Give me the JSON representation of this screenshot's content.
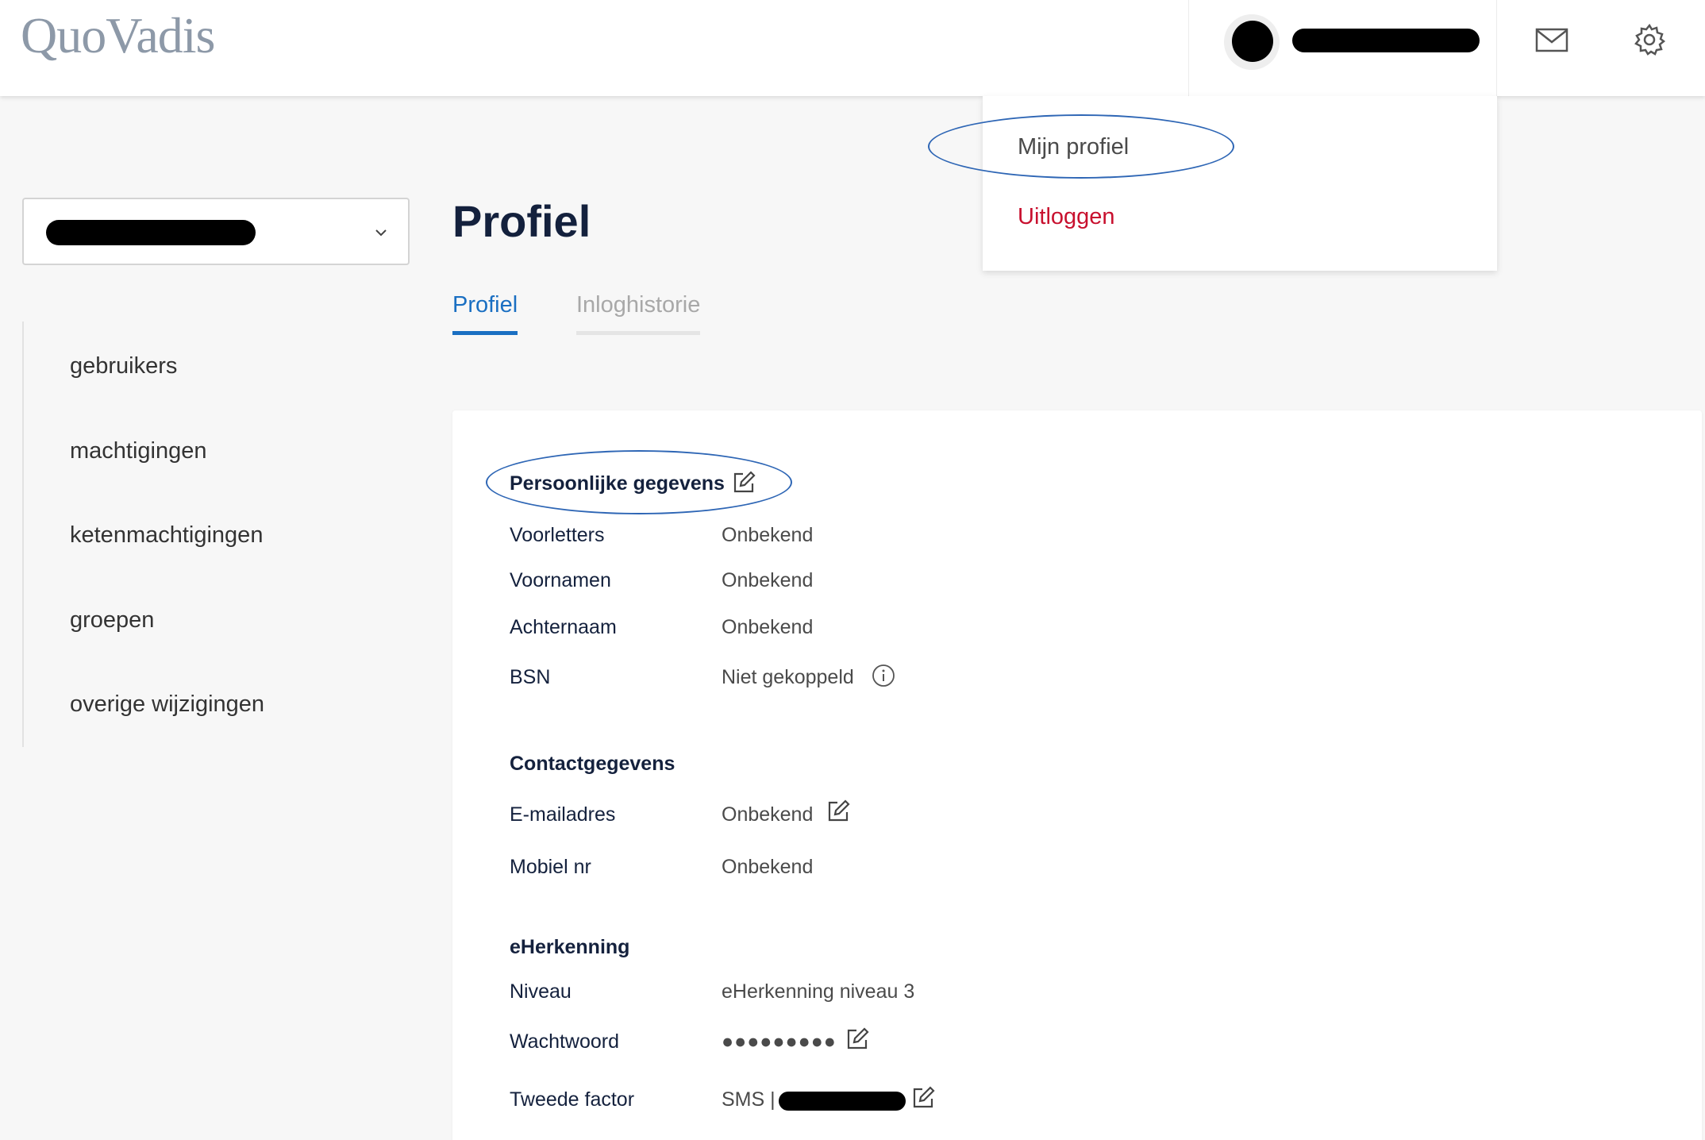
{
  "header": {
    "logo": "QuoVadis",
    "icons": [
      "mail-icon",
      "gear-icon"
    ]
  },
  "user_menu": {
    "items": [
      "Mijn profiel",
      "Uitloggen"
    ],
    "logout_color": "#c8102e"
  },
  "sidebar": {
    "items": [
      "gebruikers",
      "machtigingen",
      "ketenmachtigingen",
      "groepen",
      "overige wijzigingen"
    ]
  },
  "page": {
    "title": "Profiel",
    "tabs": [
      {
        "label": "Profiel",
        "active": true
      },
      {
        "label": "Inloghistorie",
        "active": false
      }
    ]
  },
  "persoonlijk": {
    "title": "Persoonlijke gegevens",
    "rows": [
      {
        "label": "Voorletters",
        "value": "Onbekend"
      },
      {
        "label": "Voornamen",
        "value": "Onbekend"
      },
      {
        "label": "Achternaam",
        "value": "Onbekend"
      },
      {
        "label": "BSN",
        "value": "Niet gekoppeld"
      }
    ]
  },
  "contact": {
    "title": "Contactgegevens",
    "rows": [
      {
        "label": "E-mailadres",
        "value": "Onbekend"
      },
      {
        "label": "Mobiel nr",
        "value": "Onbekend"
      }
    ]
  },
  "eherkenning": {
    "title": "eHerkenning",
    "rows": [
      {
        "label": "Niveau",
        "value": "eHerkenning niveau 3"
      },
      {
        "label": "Wachtwoord",
        "value": "●●●●●●●●●"
      },
      {
        "label": "Tweede factor",
        "value": "SMS |"
      }
    ]
  },
  "colors": {
    "accent": "#1a6fc2",
    "heading": "#14213d",
    "annotation": "#2e66b5"
  }
}
